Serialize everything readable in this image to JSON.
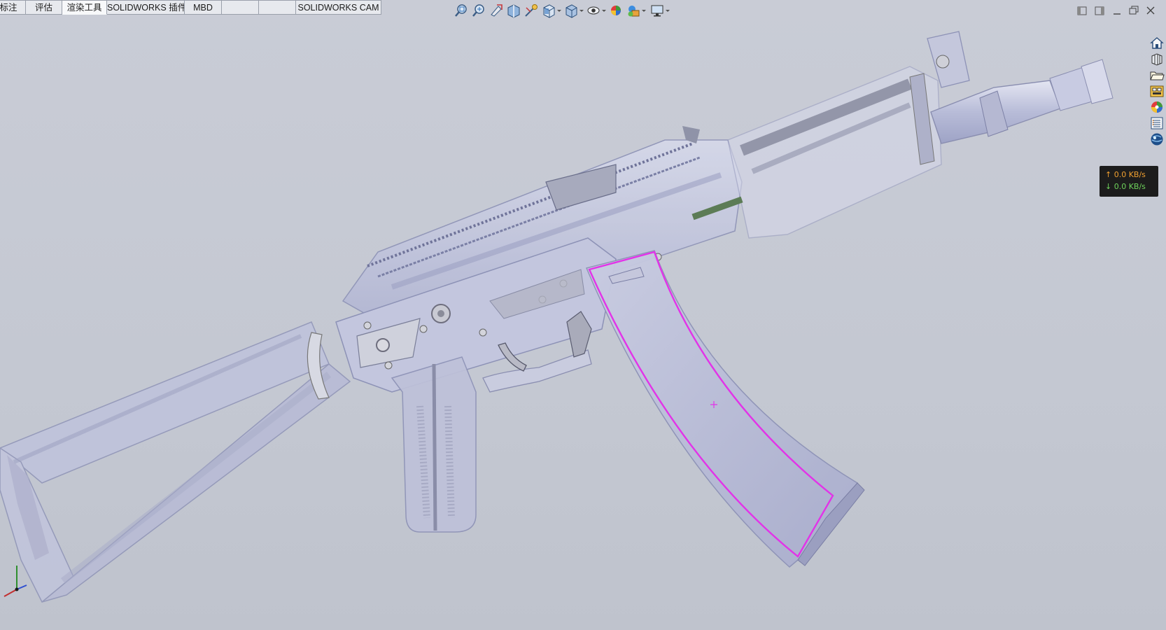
{
  "tabs": [
    {
      "label": "标注",
      "active": false
    },
    {
      "label": "评估",
      "active": false
    },
    {
      "label": "渲染工具",
      "active": true
    },
    {
      "label": "SOLIDWORKS 插件",
      "active": false
    },
    {
      "label": "MBD",
      "active": false
    },
    {
      "label": "",
      "active": false
    },
    {
      "label": "",
      "active": false
    },
    {
      "label": "SOLIDWORKS CAM",
      "active": false
    }
  ],
  "view_toolbar": {
    "icons": [
      "zoom-to-fit-icon",
      "zoom-to-area-icon",
      "previous-view-icon",
      "section-view-icon",
      "dynamic-annotation-icon",
      "view-orientation-icon",
      "display-style-icon",
      "hide-show-items-icon",
      "edit-appearance-icon",
      "apply-scene-icon",
      "view-settings-icon"
    ]
  },
  "window_controls": [
    "tile-left-icon",
    "tile-right-icon",
    "minimize-icon",
    "restore-icon",
    "close-icon"
  ],
  "task_pane": [
    "solidworks-resources-icon",
    "design-library-icon",
    "file-explorer-icon",
    "view-palette-icon",
    "appearances-icon",
    "custom-properties-icon",
    "solidworks-forum-icon"
  ],
  "network_monitor": {
    "upload": "↑ 0.0 KB/s",
    "download": "↓ 0.0 KB/s",
    "upload_color": "#f0a030",
    "download_color": "#6ed25b"
  },
  "model": {
    "name": "rifle-assembly",
    "highlight_color": "#e233e8",
    "body_color": "#b9bdd8"
  }
}
